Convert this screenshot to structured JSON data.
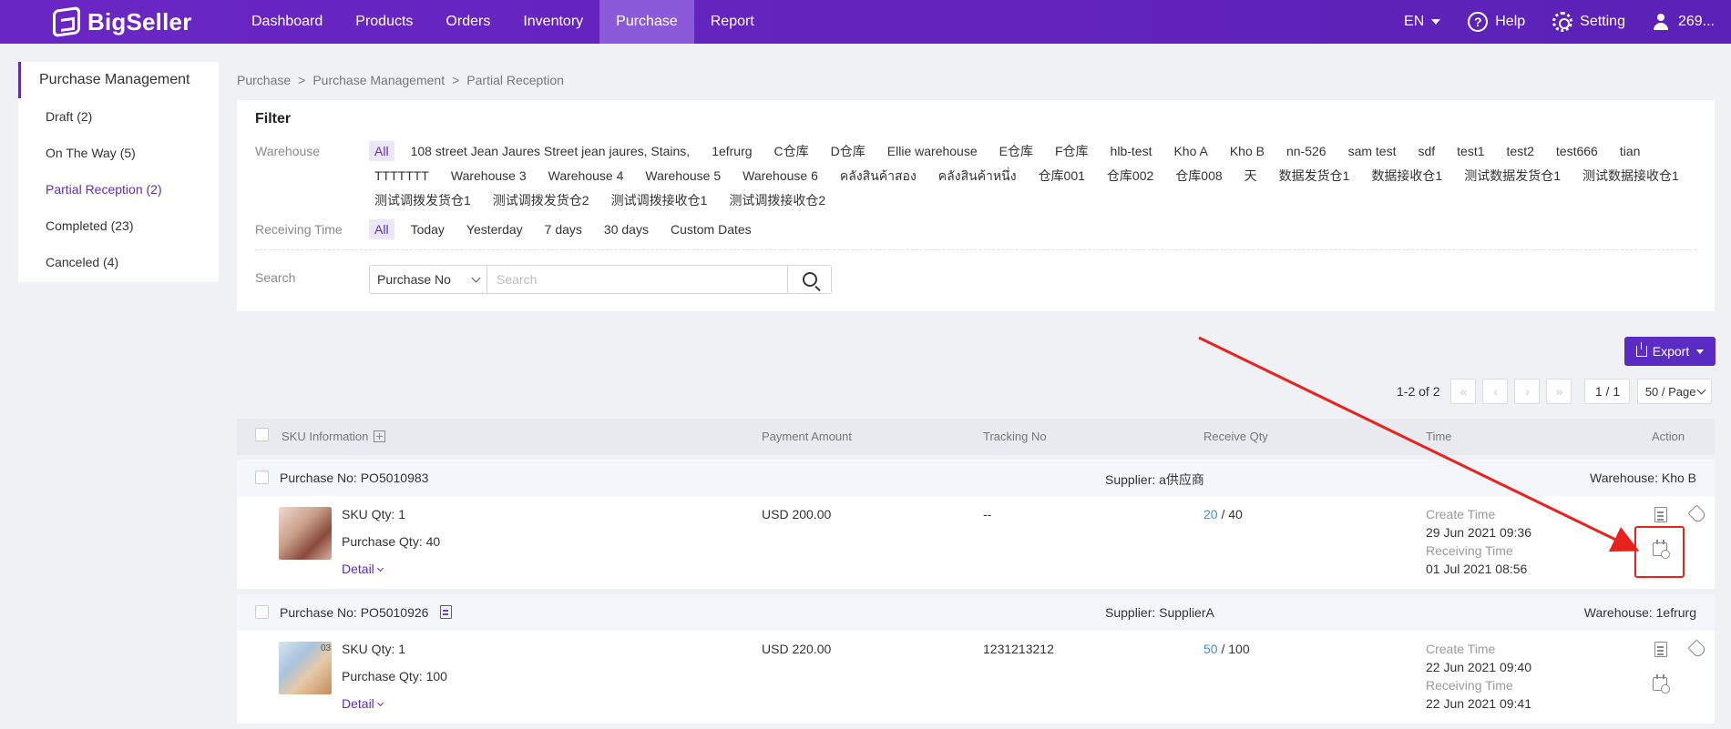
{
  "app": {
    "logo": "BigSeller"
  },
  "nav": {
    "items": [
      {
        "label": "Dashboard"
      },
      {
        "label": "Products"
      },
      {
        "label": "Orders"
      },
      {
        "label": "Inventory"
      },
      {
        "label": "Purchase"
      },
      {
        "label": "Report"
      }
    ],
    "active": "Purchase",
    "lang": "EN",
    "help": "Help",
    "setting": "Setting",
    "user": "269..."
  },
  "sidebar": {
    "title": "Purchase Management",
    "items": [
      {
        "label": "Draft",
        "count": "(2)"
      },
      {
        "label": "On The Way",
        "count": "(5)"
      },
      {
        "label": "Partial Reception",
        "count": "(2)"
      },
      {
        "label": "Completed",
        "count": "(23)"
      },
      {
        "label": "Canceled",
        "count": "(4)"
      }
    ]
  },
  "breadcrumb": [
    "Purchase",
    "Purchase Management",
    "Partial Reception"
  ],
  "filter": {
    "title": "Filter",
    "warehouse_label": "Warehouse",
    "warehouses": [
      "All",
      "108 street Jean Jaures Street jean jaures, Stains,",
      "1efrurg",
      "C仓库",
      "D仓库",
      "Ellie warehouse",
      "E仓库",
      "F仓库",
      "hlb-test",
      "Kho A",
      "Kho B",
      "nn-526",
      "sam test",
      "sdf",
      "test1",
      "test2",
      "test666",
      "tian",
      "TTTTTTT",
      "Warehouse 3",
      "Warehouse 4",
      "Warehouse 5",
      "Warehouse 6",
      "คลังสินค้าสอง",
      "คลังสินค้าหนึ่ง",
      "仓库001",
      "仓库002",
      "仓库008",
      "天",
      "数据发货仓1",
      "数据接收仓1",
      "测试数据发货仓1",
      "测试数据接收仓1",
      "测试调拨发货仓1",
      "测试调拨发货仓2",
      "测试调拨接收仓1",
      "测试调拨接收仓2"
    ],
    "receiving_label": "Receiving Time",
    "receiving_options": [
      "All",
      "Today",
      "Yesterday",
      "7 days",
      "30 days",
      "Custom Dates"
    ],
    "search_label": "Search",
    "search_type": "Purchase No",
    "search_placeholder": "Search"
  },
  "toolbar": {
    "export": "Export",
    "range": "1-2 of 2",
    "page": "1 / 1",
    "per_page": "50 / Page"
  },
  "table": {
    "headers": {
      "sku": "SKU Information",
      "payment": "Payment Amount",
      "tracking": "Tracking No",
      "receive": "Receive Qty",
      "time": "Time",
      "action": "Action"
    },
    "orders": [
      {
        "purchase_no": "Purchase No: PO5010983",
        "supplier": "Supplier: a供应商",
        "warehouse": "Warehouse: Kho B",
        "sku_qty": "SKU Qty: 1",
        "purchase_qty": "Purchase Qty: 40",
        "detail": "Detail",
        "payment": "USD 200.00",
        "tracking": "--",
        "received": "20",
        "total": "/ 40",
        "create_label": "Create Time",
        "create_time": "29 Jun 2021 09:36",
        "receive_label": "Receiving Time",
        "receive_time": "01 Jul 2021 08:56"
      },
      {
        "purchase_no": "Purchase No: PO5010926",
        "supplier": "Supplier: SupplierA",
        "warehouse": "Warehouse: 1efrurg",
        "sku_qty": "SKU Qty: 1",
        "purchase_qty": "Purchase Qty: 100",
        "detail": "Detail",
        "payment": "USD 220.00",
        "tracking": "1231213212",
        "received": "50",
        "total": "/ 100",
        "create_label": "Create Time",
        "create_time": "22 Jun 2021 09:40",
        "receive_label": "Receiving Time",
        "receive_time": "22 Jun 2021 09:41",
        "thumb_badge": "03"
      }
    ]
  },
  "colors": {
    "brand": "#5b2cc4",
    "nav_bg": "#6a26c4",
    "annotation": "#e8231e",
    "qty_blue": "#3c8fd6"
  }
}
